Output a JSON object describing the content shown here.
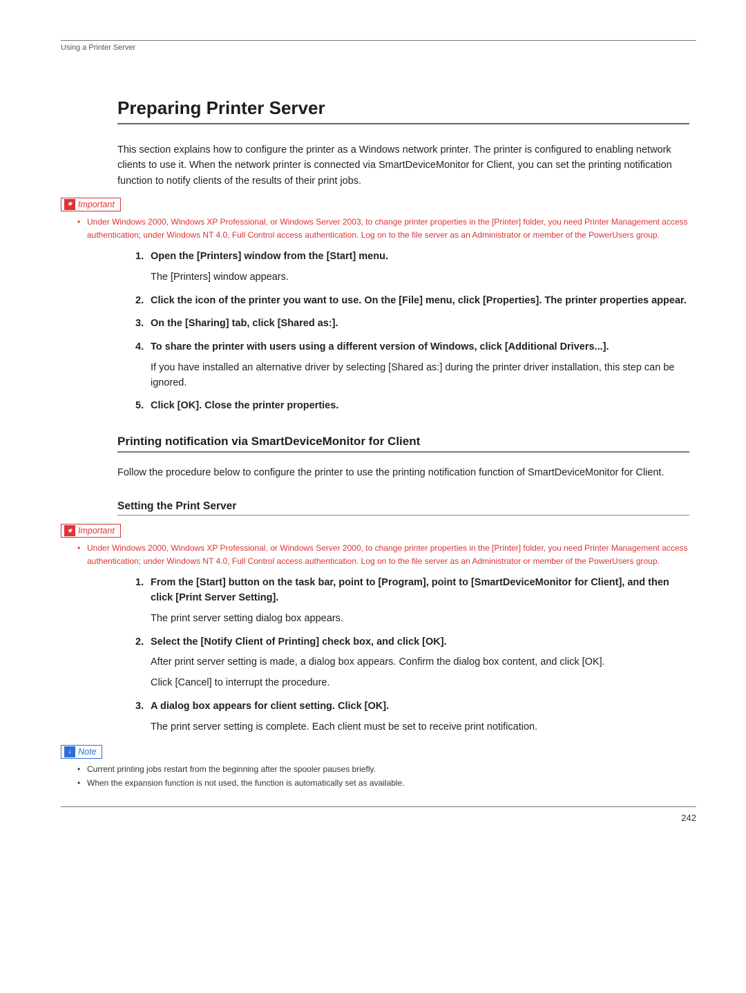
{
  "running_head": "Using a Printer Server",
  "title": "Preparing Printer Server",
  "intro": "This section explains how to configure the printer as a Windows network printer. The printer is configured to enabling network clients to use it. When the network printer is connected via SmartDeviceMonitor for Client, you can set the printing notification function to notify clients of the results of their print jobs.",
  "important_label": "Important",
  "note_label": "Note",
  "important1": {
    "items": [
      "Under Windows 2000, Windows XP Professional, or Windows Server 2003, to change printer properties in the [Printer] folder, you need Printer Management access authentication; under Windows NT 4.0, Full Control access authentication. Log on to the file server as an Administrator or member of the PowerUsers group."
    ]
  },
  "steps1": [
    {
      "title": "Open the [Printers] window from the [Start] menu.",
      "body": "The [Printers] window appears."
    },
    {
      "title": "Click the icon of the printer you want to use. On the [File] menu, click [Properties]. The printer properties appear."
    },
    {
      "title": "On the [Sharing] tab, click [Shared as:]."
    },
    {
      "title": "To share the printer with users using a different version of Windows, click [Additional Drivers...].",
      "body": "If you have installed an alternative driver by selecting [Shared as:] during the printer driver installation, this step can be ignored."
    },
    {
      "title": "Click [OK]. Close the printer properties."
    }
  ],
  "h2": "Printing notification via SmartDeviceMonitor for Client",
  "h2_body": "Follow the procedure below to configure the printer to use the printing notification function of SmartDeviceMonitor for Client.",
  "h3": "Setting the Print Server",
  "important2": {
    "items": [
      "Under Windows 2000, Windows XP Professional, or Windows Server 2000, to change printer properties in the [Printer] folder, you need Printer Management access authentication; under Windows NT 4.0, Full Control access authentication. Log on to the file server as an Administrator or member of the PowerUsers group."
    ]
  },
  "steps2": [
    {
      "title": "From the [Start] button on the task bar, point to [Program], point to [SmartDeviceMonitor for Client], and then click [Print Server Setting].",
      "body": "The print server setting dialog box appears."
    },
    {
      "title": "Select the [Notify Client of Printing] check box, and click [OK].",
      "body": "After print server setting is made, a dialog box appears. Confirm the dialog box content, and click [OK].",
      "body2": "Click [Cancel] to interrupt the procedure."
    },
    {
      "title": "A dialog box appears for client setting. Click [OK].",
      "body": "The print server setting is complete. Each client must be set to receive print notification."
    }
  ],
  "note1": {
    "items": [
      "Current printing jobs restart from the beginning after the spooler pauses briefly.",
      "When the expansion function is not used, the function is automatically set as available."
    ]
  },
  "page_number": "242"
}
